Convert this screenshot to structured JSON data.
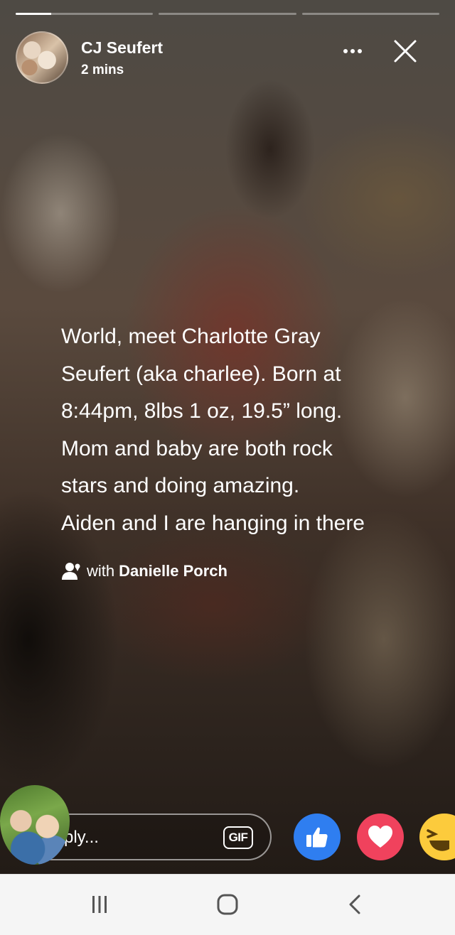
{
  "story": {
    "progress_segments": [
      0.3,
      0,
      0
    ],
    "author_name": "CJ Seufert",
    "posted_time": "2 mins",
    "text": "World, meet Charlotte Gray\nSeufert (aka charlee). Born at\n8:44pm, 8lbs 1 oz, 19.5” long.\nMom and baby are both rock\nstars and doing amazing.\nAiden and I are hanging in there",
    "tag_prefix": "with",
    "tagged_person": "Danielle Porch"
  },
  "reply": {
    "placeholder_visible": "ply...",
    "gif_label": "GIF"
  },
  "reactions": [
    {
      "name": "like",
      "color": "#2f7ef0"
    },
    {
      "name": "love",
      "color": "#f0425d"
    },
    {
      "name": "haha",
      "color": "#fccb3c"
    }
  ],
  "icons": {
    "more": "more-horizontal-icon",
    "close": "close-icon",
    "tag": "people-tag-icon",
    "nav_recent": "recent-apps-icon",
    "nav_home": "home-icon",
    "nav_back": "back-icon"
  }
}
